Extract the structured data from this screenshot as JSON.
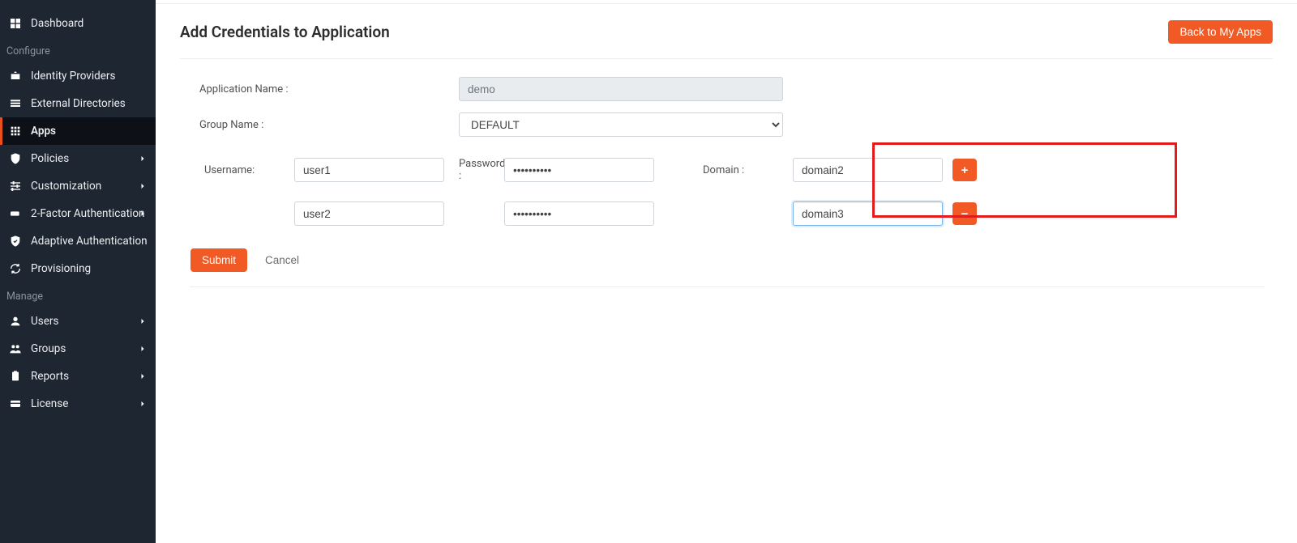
{
  "sidebar": {
    "items": [
      {
        "label": "Dashboard"
      }
    ],
    "section_configure": "Configure",
    "configure_items": [
      {
        "label": "Identity Providers"
      },
      {
        "label": "External Directories"
      },
      {
        "label": "Apps"
      },
      {
        "label": "Policies"
      },
      {
        "label": "Customization"
      },
      {
        "label": "2-Factor Authentication"
      },
      {
        "label": "Adaptive Authentication"
      },
      {
        "label": "Provisioning"
      }
    ],
    "section_manage": "Manage",
    "manage_items": [
      {
        "label": "Users"
      },
      {
        "label": "Groups"
      },
      {
        "label": "Reports"
      },
      {
        "label": "License"
      }
    ]
  },
  "header": {
    "title": "Add Credentials to Application",
    "back_btn": "Back to My Apps"
  },
  "form": {
    "app_name_label": "Application Name :",
    "app_name_value": "demo",
    "group_name_label": "Group Name :",
    "group_name_value": "DEFAULT",
    "username_label": "Username:",
    "password_label": "Password :",
    "domain_label": "Domain :",
    "rows": [
      {
        "username": "user1",
        "password": "••••••••••",
        "domain": "domain2"
      },
      {
        "username": "user2",
        "password": "••••••••••",
        "domain": "domain3"
      }
    ],
    "submit": "Submit",
    "cancel": "Cancel"
  }
}
